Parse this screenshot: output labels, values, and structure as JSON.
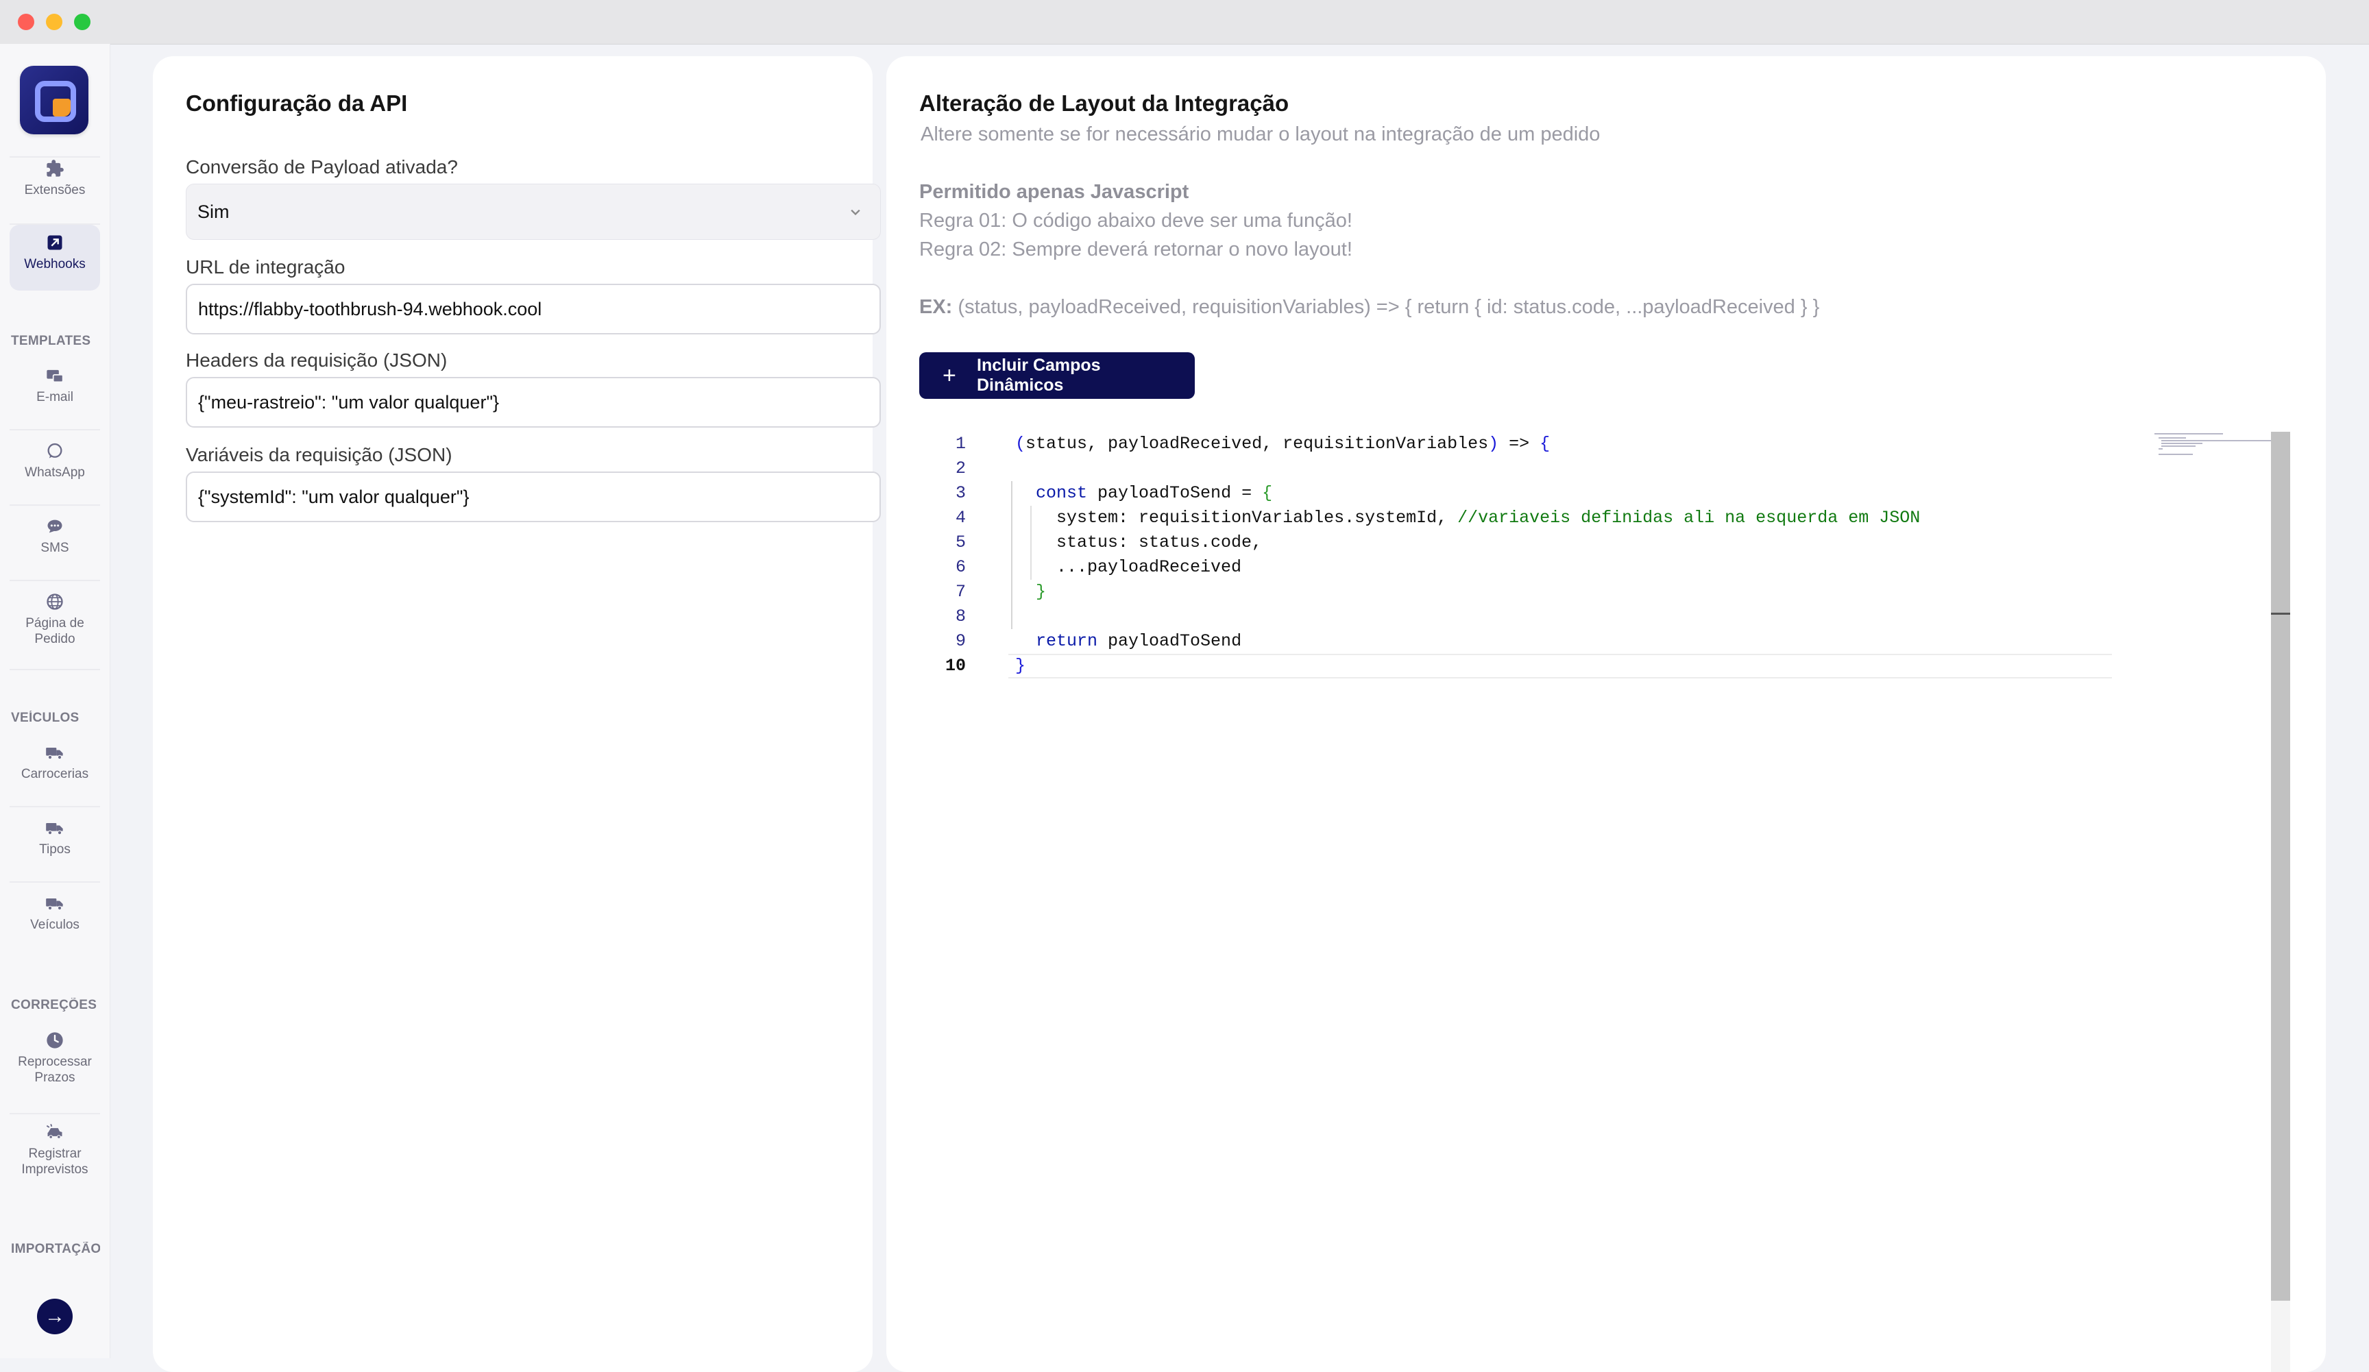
{
  "sidebar": {
    "items": [
      {
        "id": "extensoes",
        "label": "Extensões",
        "icon": "puzzle-icon"
      },
      {
        "id": "webhooks",
        "label": "Webhooks",
        "icon": "webhook-icon",
        "active": true
      },
      {
        "id": "email",
        "label": "E-mail",
        "icon": "email-icon"
      },
      {
        "id": "whatsapp",
        "label": "WhatsApp",
        "icon": "whatsapp-icon"
      },
      {
        "id": "sms",
        "label": "SMS",
        "icon": "sms-icon"
      },
      {
        "id": "pagina",
        "label": "Página de Pedido",
        "icon": "globe-icon"
      },
      {
        "id": "carrocerias",
        "label": "Carrocerias",
        "icon": "truck-icon"
      },
      {
        "id": "tipos",
        "label": "Tipos",
        "icon": "truck-icon"
      },
      {
        "id": "veiculos",
        "label": "Veículos",
        "icon": "truck-icon"
      },
      {
        "id": "reprocessar",
        "label": "Reprocessar Prazos",
        "icon": "clock-icon"
      },
      {
        "id": "registrar",
        "label": "Registrar Imprevistos",
        "icon": "car-crash-icon"
      }
    ],
    "sections": {
      "templates": "TEMPLATES",
      "veiculos": "VEÍCULOS",
      "correcoes": "CORREÇÕES",
      "importacao": "IMPORTAÇÃO"
    }
  },
  "api_config": {
    "title": "Configuração da API",
    "payload_label": "Conversão de Payload ativada?",
    "payload_value": "Sim",
    "url_label": "URL de integração",
    "url_value": "https://flabby-toothbrush-94.webhook.cool",
    "headers_label": "Headers da requisição (JSON)",
    "headers_value": "{\"meu-rastreio\": \"um valor qualquer\"}",
    "vars_label": "Variáveis da requisição (JSON)",
    "vars_value": "{\"systemId\": \"um valor qualquer\"}"
  },
  "layout_change": {
    "title": "Alteração de Layout da Integração",
    "subtitle": "Altere somente se for necessário mudar o layout na integração de um pedido",
    "rules_title": "Permitido apenas Javascript",
    "rule1": "Regra 01: O código abaixo deve ser uma função!",
    "rule2": "Regra 02: Sempre deverá retornar o novo layout!",
    "example_label": "EX:",
    "example_text": "(status, payloadReceived, requisitionVariables) => { return { id: status.code, ...payloadReceived } }",
    "button_label": "Incluir Campos Dinâmicos",
    "code_lines": [
      {
        "n": "1",
        "segments": [
          {
            "t": "(",
            "c": "br"
          },
          {
            "t": "status, payloadReceived, requisitionVariables",
            "c": ""
          },
          {
            "t": ")",
            "c": "br"
          },
          {
            "t": " => ",
            "c": ""
          },
          {
            "t": "{",
            "c": "br"
          }
        ]
      },
      {
        "n": "2",
        "segments": []
      },
      {
        "n": "3",
        "segments": [
          {
            "t": "  ",
            "c": ""
          },
          {
            "t": "const",
            "c": "kw"
          },
          {
            "t": " payloadToSend = ",
            "c": ""
          },
          {
            "t": "{",
            "c": "br2"
          }
        ]
      },
      {
        "n": "4",
        "segments": [
          {
            "t": "    system: requisitionVariables.systemId, ",
            "c": ""
          },
          {
            "t": "//variaveis definidas ali na esquerda em JSON",
            "c": "cm"
          }
        ]
      },
      {
        "n": "5",
        "segments": [
          {
            "t": "    status: status.code,",
            "c": ""
          }
        ]
      },
      {
        "n": "6",
        "segments": [
          {
            "t": "    ...payloadReceived",
            "c": ""
          }
        ]
      },
      {
        "n": "7",
        "segments": [
          {
            "t": "  ",
            "c": ""
          },
          {
            "t": "}",
            "c": "br2"
          }
        ]
      },
      {
        "n": "8",
        "segments": []
      },
      {
        "n": "9",
        "segments": [
          {
            "t": "  ",
            "c": ""
          },
          {
            "t": "return",
            "c": "kw"
          },
          {
            "t": " payloadToSend",
            "c": ""
          }
        ]
      },
      {
        "n": "10",
        "segments": [
          {
            "t": "}",
            "c": "br"
          }
        ],
        "current": true
      }
    ]
  },
  "colors": {
    "brand_navy": "#0d0f52",
    "accent_orange": "#f39b2a"
  }
}
